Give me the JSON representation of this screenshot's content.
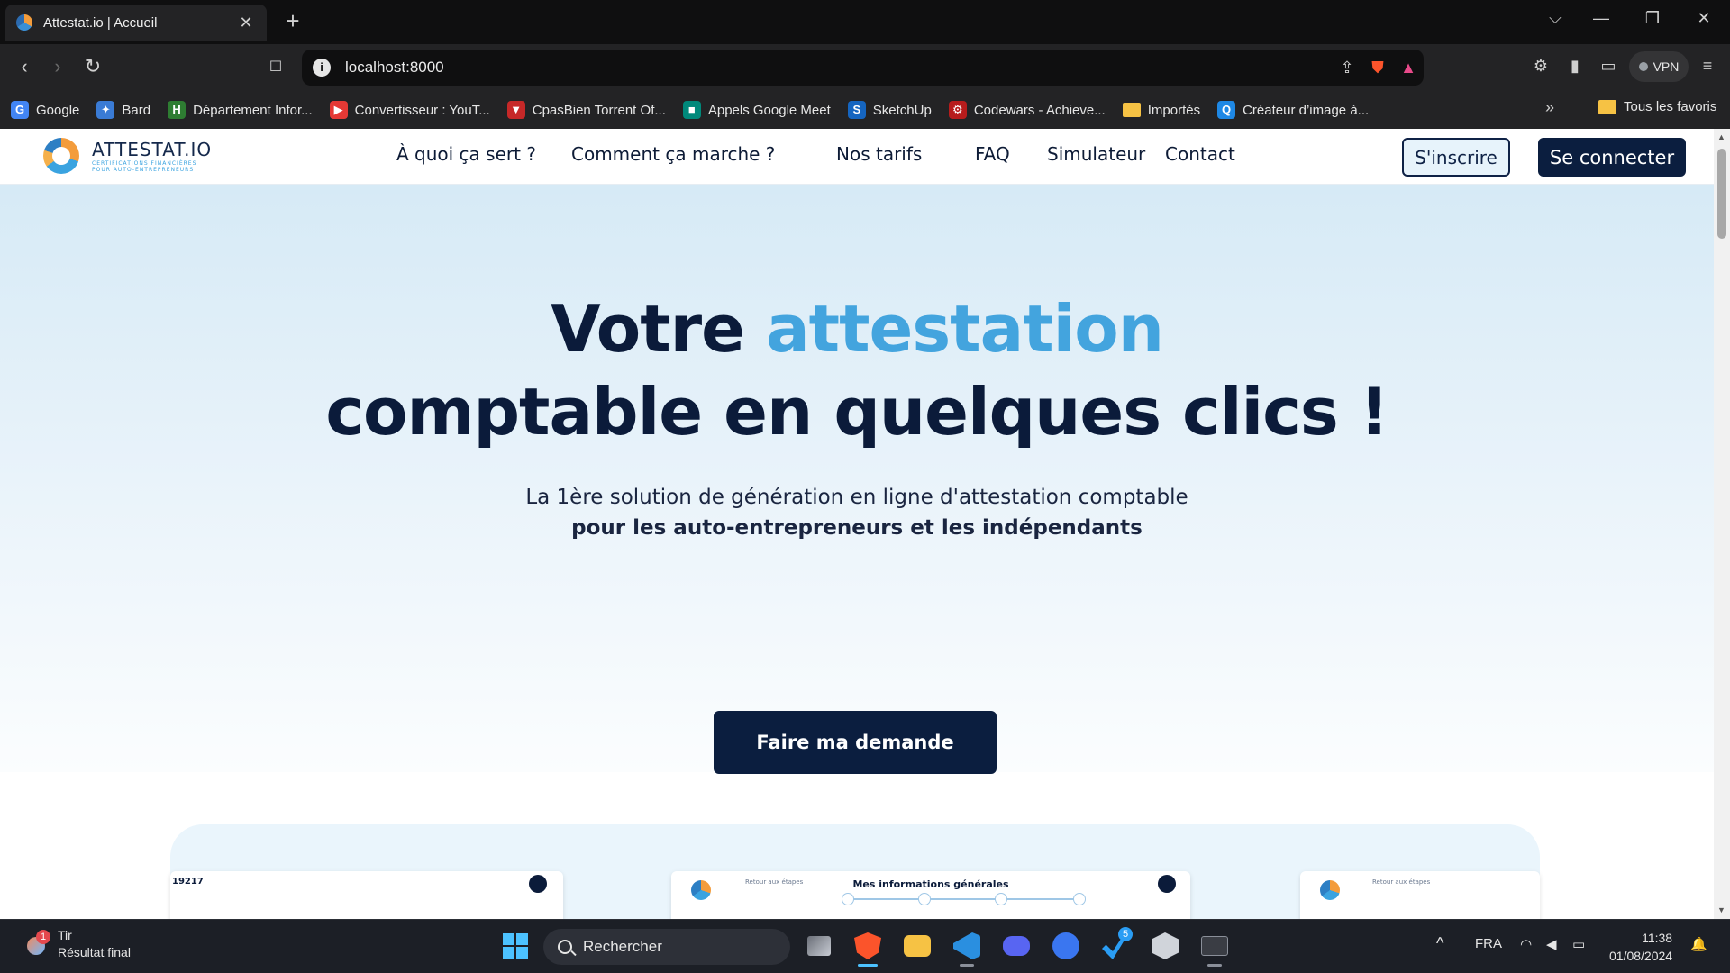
{
  "browser": {
    "tab": {
      "title": "Attestat.io | Accueil",
      "close": "✕"
    },
    "new_tab": "+",
    "window_controls": {
      "dropdown": "⌵",
      "minimize": "—",
      "maximize": "❐",
      "close": "✕"
    },
    "nav": {
      "back": "‹",
      "forward": "›",
      "reload": "↻",
      "bookmark": "🔖"
    },
    "address": {
      "url": "localhost:8000",
      "info_icon": "i"
    },
    "toolbar_right": {
      "vpn_label": "VPN"
    },
    "bookmarks": [
      {
        "label": "Google",
        "color": "#4285f4",
        "glyph": "G"
      },
      {
        "label": "Bard",
        "color": "#3a7bd5",
        "glyph": "✦"
      },
      {
        "label": "Département Infor...",
        "color": "#2e7d32",
        "glyph": "H"
      },
      {
        "label": "Convertisseur : YouT...",
        "color": "#e53935",
        "glyph": "▶"
      },
      {
        "label": "CpasBien Torrent Of...",
        "color": "#c62828",
        "glyph": "▼"
      },
      {
        "label": "Appels Google Meet",
        "color": "#00897b",
        "glyph": "■"
      },
      {
        "label": "SketchUp",
        "color": "#1565c0",
        "glyph": "S"
      },
      {
        "label": "Codewars - Achieve...",
        "color": "#b71c1c",
        "glyph": "⚙"
      },
      {
        "label": "Importés",
        "color": "#f6c244",
        "glyph": ""
      },
      {
        "label": "Créateur d’image à...",
        "color": "#1e88e5",
        "glyph": "Q"
      }
    ],
    "bookmarks_more": "»",
    "bookmarks_all": "Tous les favoris"
  },
  "site": {
    "logo": {
      "name": "ATTESTAT.IO",
      "tagline_1": "CERTIFICATIONS FINANCIÈRES",
      "tagline_2": "POUR AUTO-ENTREPRENEURS"
    },
    "nav": [
      "À quoi ça sert ?",
      "Comment ça marche ?",
      "Nos tarifs",
      "FAQ",
      "Simulateur",
      "Contact"
    ],
    "signup": "S'inscrire",
    "login": "Se connecter",
    "hero": {
      "title_part1": "Votre ",
      "title_accent": "attestation",
      "title_line2": "comptable en quelques clics !",
      "subtitle_1": "La 1ère solution de génération en ligne d'attestation comptable",
      "subtitle_2": "pour les auto-entrepreneurs et les indépendants",
      "cta": "Faire ma demande"
    },
    "showcase": {
      "shot1_id": "19217",
      "shot2_back": "Retour aux étapes",
      "shot2_title": "Mes informations générales",
      "shot3_back": "Retour aux étapes"
    }
  },
  "taskbar": {
    "weather": {
      "badge": "1",
      "line1": "Tir",
      "line2": "Résultat final"
    },
    "search_placeholder": "Rechercher",
    "steam_badge": "5",
    "tray": {
      "chevron": "^",
      "lang": "FRA"
    },
    "clock": {
      "time": "11:38",
      "date": "01/08/2024"
    }
  }
}
